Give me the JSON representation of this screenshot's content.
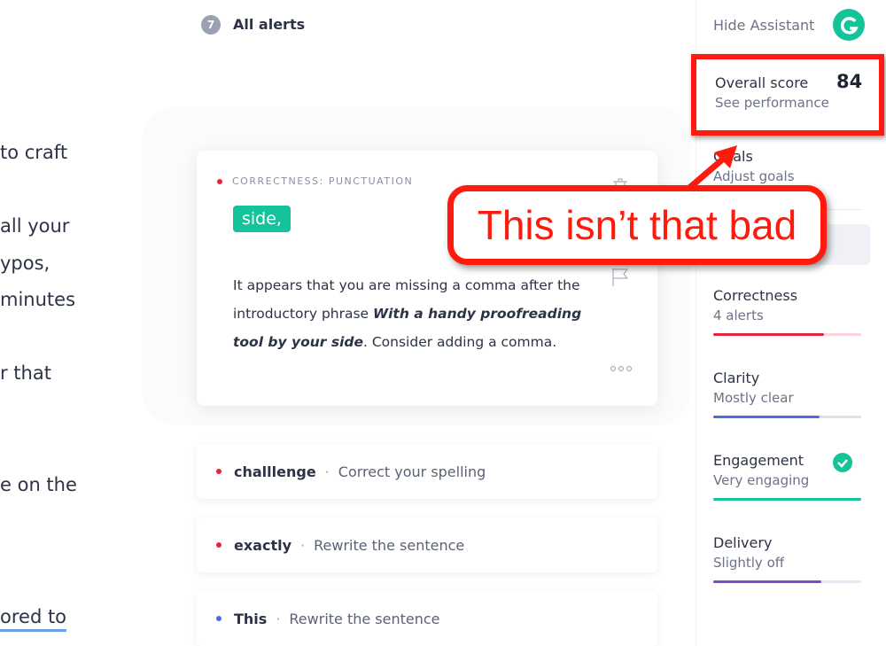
{
  "document": {
    "fragments": [
      "to craft",
      "all your",
      "ypos,",
      "minutes",
      "r that",
      "e on the",
      "ored to"
    ]
  },
  "alerts_header": {
    "count": "7",
    "label": "All alerts"
  },
  "active_card": {
    "category": "CORRECTNESS: PUNCTUATION",
    "suggestion": "side,",
    "text_1": "It appears that you are missing a comma after the introductory phrase ",
    "phrase": "With a handy proofreading tool by your side",
    "text_2": ". Consider adding a comma."
  },
  "alerts": [
    {
      "word": "challlenge",
      "desc": "Correct your spelling",
      "color": "#e5233d"
    },
    {
      "word": "exactly",
      "desc": "Rewrite the sentence",
      "color": "#e5233d"
    },
    {
      "word": "This",
      "desc": "Rewrite the sentence",
      "color": "#4a6ee0"
    }
  ],
  "sidebar": {
    "hide": "Hide Assistant",
    "overall": {
      "label": "Overall score",
      "value": "84",
      "sub": "See performance"
    },
    "goals": {
      "label": "Goals",
      "sub": "Adjust goals"
    },
    "categories": [
      {
        "label": "Correctness",
        "sub": "4 alerts",
        "color": "#e5233d",
        "track": "#fbd3d8",
        "fill": 0.75
      },
      {
        "label": "Clarity",
        "sub": "Mostly clear",
        "color": "#4a6ee0",
        "track": "#dbe3f0",
        "fill": 0.72
      },
      {
        "label": "Engagement",
        "sub": "Very engaging",
        "color": "#15c39a",
        "track": "#cdf1e6",
        "fill": 1.0
      },
      {
        "label": "Delivery",
        "sub": "Slightly off",
        "color": "#7c4bc9",
        "track": "#ece4f6",
        "fill": 0.73
      }
    ]
  },
  "annotation": {
    "text": "This isn’t that bad"
  }
}
